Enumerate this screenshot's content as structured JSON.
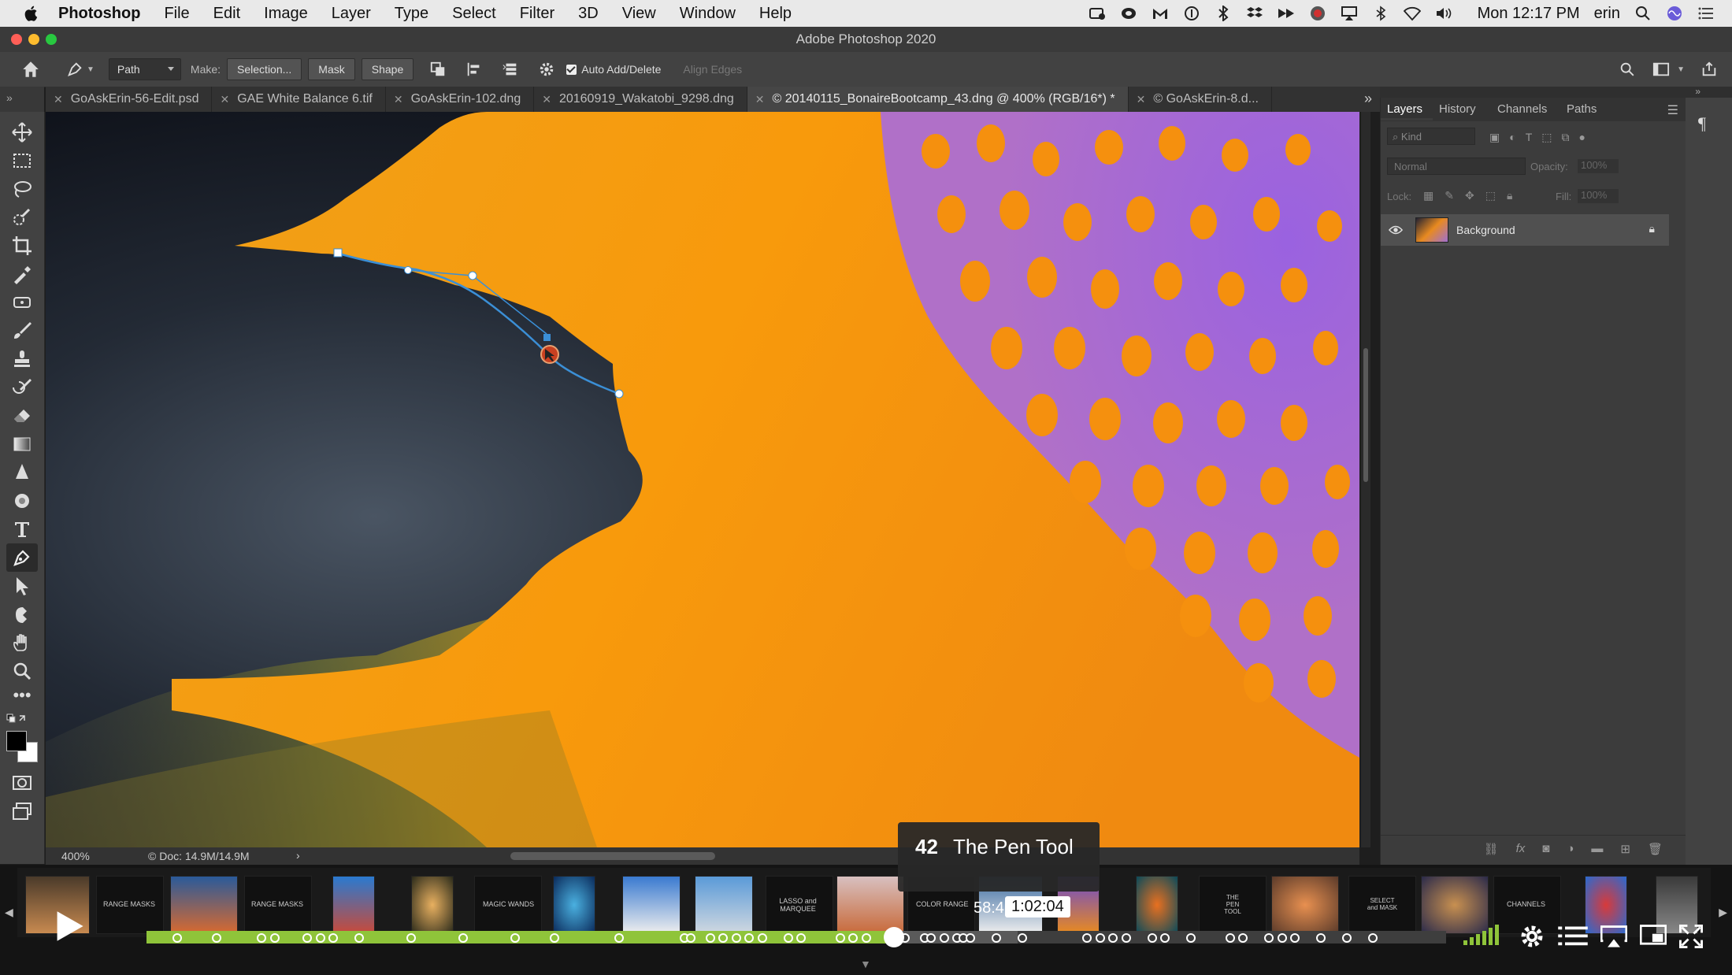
{
  "menubar": {
    "app_name": "Photoshop",
    "items": [
      "File",
      "Edit",
      "Image",
      "Layer",
      "Type",
      "Select",
      "Filter",
      "3D",
      "View",
      "Window",
      "Help"
    ],
    "clock": "Mon 12:17 PM",
    "user": "erin"
  },
  "window": {
    "title": "Adobe Photoshop 2020"
  },
  "options": {
    "mode_value": "Path",
    "make_label": "Make:",
    "selection_btn": "Selection...",
    "mask_btn": "Mask",
    "shape_btn": "Shape",
    "auto_add_label": "Auto Add/Delete",
    "align_edges_label": "Align Edges"
  },
  "tabs": [
    {
      "label": "GoAskErin-56-Edit.psd"
    },
    {
      "label": "GAE White Balance 6.tif"
    },
    {
      "label": "GoAskErin-102.dng"
    },
    {
      "label": "20160919_Wakatobi_9298.dng"
    },
    {
      "label": "© 20140115_BonaireBootcamp_43.dng @ 400% (RGB/16*) *"
    },
    {
      "label": "© GoAskErin-8.d..."
    }
  ],
  "status": {
    "zoom": "400%",
    "doc": "© Doc: 14.9M/14.9M"
  },
  "panel": {
    "tabs": [
      "Layers",
      "History",
      "Channels",
      "Paths"
    ],
    "kind_placeholder": "Kind",
    "blend_mode": "Normal",
    "opacity_label": "Opacity:",
    "opacity_value": "100%",
    "lock_label": "Lock:",
    "fill_label": "Fill:",
    "fill_value": "100%",
    "layer_name": "Background"
  },
  "player": {
    "chapter_number": "42",
    "chapter_title": "The Pen Tool",
    "hover_time": "58:4",
    "current_time": "1:02:04",
    "progress_fraction": 0.575,
    "thumb_labels": [
      "RANGE MASKS",
      "RANGE MASKS",
      "MAGIC WANDS",
      "LASSO and MARQUEE",
      "COLOR RANGE",
      "THE PEN TOOL",
      "SELECT and MASK",
      "CHANNELS"
    ]
  },
  "colors": {
    "accent_green": "#8fc43a",
    "path_blue": "#3b8fd6",
    "fish_orange": "#f59a10",
    "fish_purple": "#a56ad8"
  }
}
